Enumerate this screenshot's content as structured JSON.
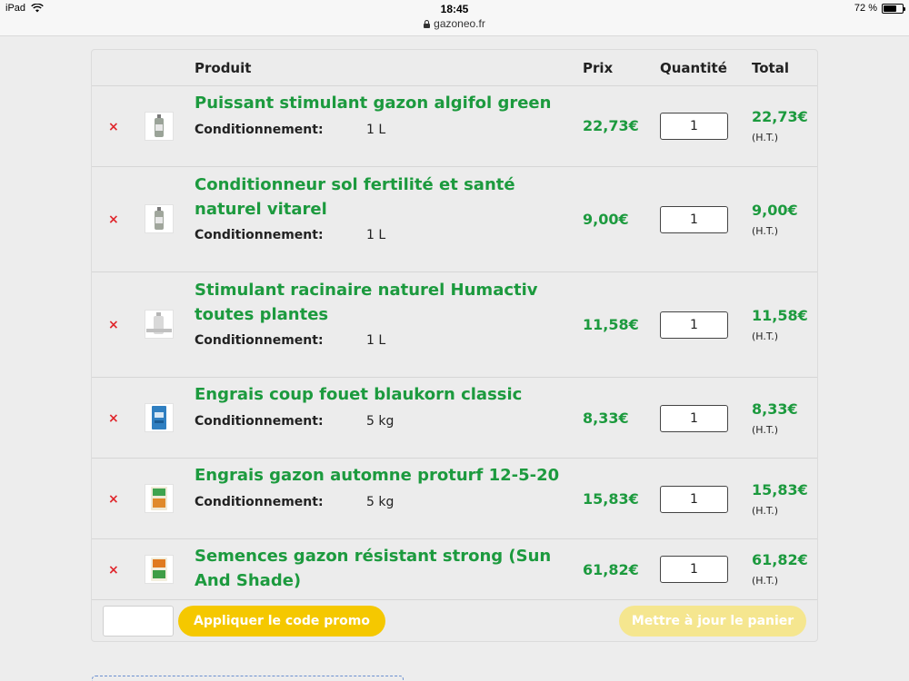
{
  "status_bar": {
    "device": "iPad",
    "time": "18:45",
    "url": "gazoneo.fr",
    "battery": "72 %",
    "battery_level": 0.72
  },
  "cart": {
    "headers": {
      "product": "Produit",
      "price": "Prix",
      "quantity": "Quantité",
      "total": "Total"
    },
    "cond_label": "Conditionnement:",
    "ht_label": "(H.T.)",
    "items": [
      {
        "title": "Puissant stimulant gazon algifol green",
        "cond": "1 L",
        "price": "22,73€",
        "qty": "1",
        "total": "22,73€",
        "thumb": "bottle-icon"
      },
      {
        "title": "Conditionneur sol fertilité et santé naturel vitarel",
        "cond": "1 L",
        "price": "9,00€",
        "qty": "1",
        "total": "9,00€",
        "thumb": "bottle-icon"
      },
      {
        "title": "Stimulant racinaire naturel Humactiv toutes plantes",
        "cond": "1 L",
        "price": "11,58€",
        "qty": "1",
        "total": "11,58€",
        "thumb": "bottle-icon"
      },
      {
        "title": "Engrais coup fouet blaukorn classic",
        "cond": "5 kg",
        "price": "8,33€",
        "qty": "1",
        "total": "8,33€",
        "thumb": "bag-icon"
      },
      {
        "title": "Engrais gazon automne proturf 12-5-20",
        "cond": "5 kg",
        "price": "15,83€",
        "qty": "1",
        "total": "15,83€",
        "thumb": "bag-icon"
      },
      {
        "title": "Semences gazon résistant strong (Sun And Shade)",
        "price": "61,82€",
        "qty": "1",
        "total": "61,82€",
        "thumb": "bag-icon"
      }
    ],
    "promo_button": "Appliquer le code promo",
    "update_button": "Mettre à jour le panier"
  },
  "colors": {
    "accent_green": "#1c9a3e",
    "remove_red": "#e0262c",
    "promo_yellow": "#f5c800",
    "update_yellow_disabled": "#f5e68f"
  }
}
